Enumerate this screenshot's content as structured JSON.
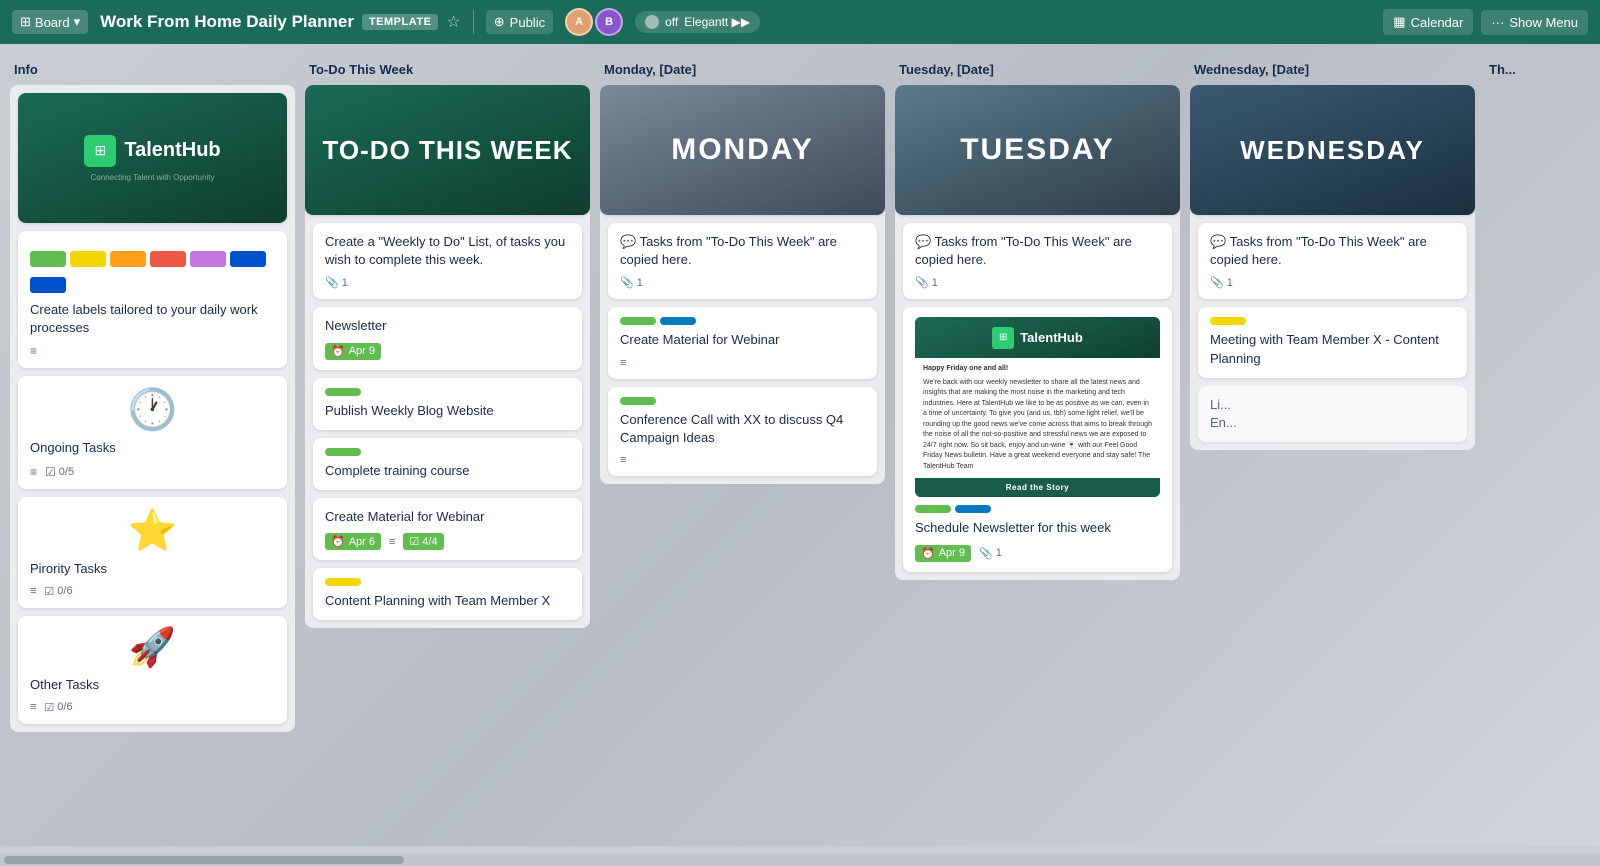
{
  "topnav": {
    "board_btn": "Board",
    "board_chevron": "▾",
    "title": "Work From Home Daily Planner",
    "template_badge": "TEMPLATE",
    "star_icon": "☆",
    "public_icon": "⊕",
    "public_label": "Public",
    "toggle_label": "off",
    "toggle_brand": "Elegantt ▶▶",
    "calendar_icon": "▦",
    "calendar_label": "Calendar",
    "more_icon": "···",
    "show_menu_label": "Show Menu"
  },
  "columns": {
    "info": {
      "header": "Info",
      "cards": [
        {
          "type": "logo",
          "title": null,
          "logo_text": "TalentHub",
          "tagline": "Connecting Talent with Opportunity"
        },
        {
          "type": "labels",
          "title": "Create labels tailored to your daily work processes",
          "meta_icon": "≡"
        },
        {
          "type": "task",
          "icon": "🕐",
          "title": "Ongoing Tasks",
          "meta_list": "≡",
          "meta_check": "☑",
          "checklist_val": "0/5"
        },
        {
          "type": "task",
          "icon": "⭐",
          "title": "Pirority Tasks",
          "meta_list": "≡",
          "meta_check": "☑",
          "checklist_val": "0/6"
        },
        {
          "type": "task",
          "icon": "🚀",
          "title": "Other Tasks",
          "meta_list": "≡",
          "meta_check": "☑",
          "checklist_val": "0/6"
        }
      ]
    },
    "todo": {
      "header": "To-Do This Week",
      "banner_text": "TO-DO THIS WEEK",
      "cards": [
        {
          "title": "Create a \"Weekly to Do\" List, of tasks you wish to complete this week.",
          "meta_clip": "📎",
          "clip_val": "1"
        },
        {
          "title": "Newsletter",
          "date_label": "Apr 9",
          "date_color": "green"
        },
        {
          "title": "Publish Weekly Blog Website",
          "label_color": "green"
        },
        {
          "title": "Complete training course",
          "label_color": "green"
        },
        {
          "title": "Create Material for Webinar",
          "date_label": "Apr 6",
          "checklist_label": "4/4"
        },
        {
          "title": "Content Planning with Team Member X",
          "label_color": "yellow"
        }
      ]
    },
    "monday": {
      "header": "Monday, [Date]",
      "banner_text": "MONDAY",
      "banner_class": "banner-monday",
      "cards": [
        {
          "title": "💬 Tasks from \"To-Do This Week\" are copied here.",
          "meta_clip": "📎",
          "clip_val": "1"
        },
        {
          "title": "Create Material for Webinar",
          "labels": [
            "green",
            "blue"
          ],
          "meta_list": "≡"
        },
        {
          "title": "Conference Call with XX to discuss Q4 Campaign Ideas",
          "labels": [
            "green"
          ],
          "meta_list": "≡"
        }
      ]
    },
    "tuesday": {
      "header": "Tuesday, [Date]",
      "banner_text": "TUESDAY",
      "banner_class": "banner-tuesday",
      "cards": [
        {
          "title": "💬 Tasks from \"To-Do This Week\" are copied here.",
          "meta_clip": "📎",
          "clip_val": "1"
        },
        {
          "type": "newsletter_image",
          "title": "Schedule Newsletter for this week",
          "labels": [
            "green",
            "blue"
          ],
          "date_label": "Apr 9",
          "clip_val": "1"
        }
      ]
    },
    "wednesday": {
      "header": "Wednesday, [Date]",
      "banner_text": "WEDNESDAY",
      "banner_class": "banner-wednesday",
      "cards": [
        {
          "title": "💬 Tasks from \"To-Do This Week\" are copied here.",
          "meta_clip": "📎",
          "clip_val": "1"
        },
        {
          "title": "Meeting with Team Member X - Content Planning",
          "labels": [
            "yellow"
          ]
        },
        {
          "title": "Li...\nEn...",
          "partial": true
        }
      ]
    },
    "thursday_partial": {
      "header": "Th...",
      "partial": true
    }
  }
}
